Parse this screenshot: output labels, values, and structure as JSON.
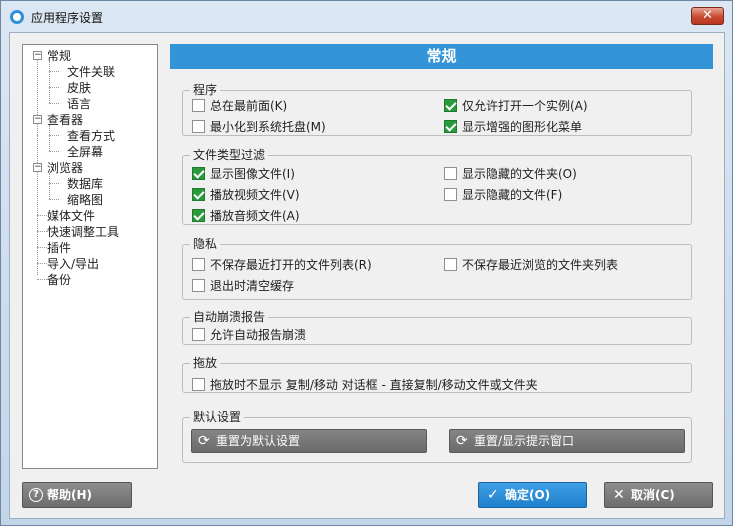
{
  "window": {
    "title": "应用程序设置",
    "close_label": "✕"
  },
  "tree": {
    "items": [
      {
        "label": "常规",
        "level": 0,
        "expander": "−"
      },
      {
        "label": "文件关联",
        "level": 1
      },
      {
        "label": "皮肤",
        "level": 1
      },
      {
        "label": "语言",
        "level": 1
      },
      {
        "label": "查看器",
        "level": 0,
        "expander": "−"
      },
      {
        "label": "查看方式",
        "level": 1
      },
      {
        "label": "全屏幕",
        "level": 1
      },
      {
        "label": "浏览器",
        "level": 0,
        "expander": "−"
      },
      {
        "label": "数据库",
        "level": 1
      },
      {
        "label": "缩略图",
        "level": 1
      },
      {
        "label": "媒体文件",
        "level": 0
      },
      {
        "label": "快速调整工具",
        "level": 0
      },
      {
        "label": "插件",
        "level": 0
      },
      {
        "label": "导入/导出",
        "level": 0
      },
      {
        "label": "备份",
        "level": 0
      }
    ]
  },
  "panel": {
    "header": "常规"
  },
  "groups": {
    "program": {
      "title": "程序",
      "options": [
        {
          "label": "总在最前面(K)",
          "checked": false
        },
        {
          "label": "仅允许打开一个实例(A)",
          "checked": true
        },
        {
          "label": "最小化到系统托盘(M)",
          "checked": false
        },
        {
          "label": "显示增强的图形化菜单",
          "checked": true
        }
      ]
    },
    "filter": {
      "title": "文件类型过滤",
      "options": [
        {
          "label": "显示图像文件(I)",
          "checked": true
        },
        {
          "label": "显示隐藏的文件夹(O)",
          "checked": false
        },
        {
          "label": "播放视频文件(V)",
          "checked": true
        },
        {
          "label": "显示隐藏的文件(F)",
          "checked": false
        },
        {
          "label": "播放音频文件(A)",
          "checked": true
        }
      ]
    },
    "privacy": {
      "title": "隐私",
      "options": [
        {
          "label": "不保存最近打开的文件列表(R)",
          "checked": false
        },
        {
          "label": "不保存最近浏览的文件夹列表",
          "checked": false
        },
        {
          "label": "退出时清空缓存",
          "checked": false
        }
      ]
    },
    "crash": {
      "title": "自动崩溃报告",
      "options": [
        {
          "label": "允许自动报告崩溃",
          "checked": false
        }
      ]
    },
    "dragdrop": {
      "title": "拖放",
      "options": [
        {
          "label": "拖放时不显示 复制/移动 对话框 - 直接复制/移动文件或文件夹",
          "checked": false
        }
      ]
    },
    "defaults": {
      "title": "默认设置",
      "reset_defaults": "重置为默认设置",
      "reset_tips": "重置/显示提示窗口"
    }
  },
  "footer": {
    "help": "帮助(H)",
    "ok": "确定(O)",
    "cancel": "取消(C)"
  },
  "icons": {
    "refresh": "refresh-icon",
    "check": "check-icon",
    "close": "close-icon",
    "help": "help-icon"
  },
  "colors": {
    "header_blue": "#3395d8",
    "checkbox_green": "#2a9a3c",
    "ok_blue": "#1f7fcb"
  }
}
